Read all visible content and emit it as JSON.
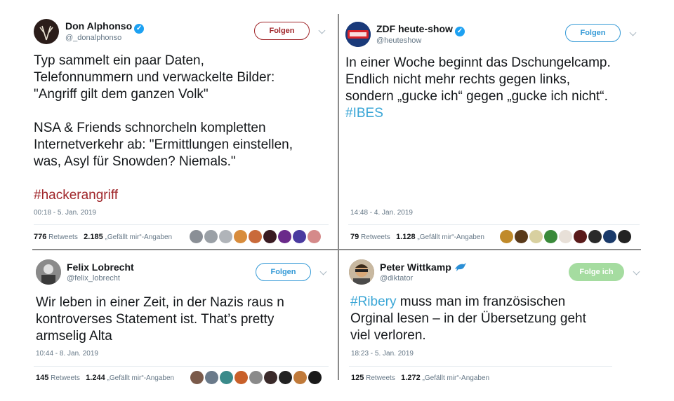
{
  "tweets": [
    {
      "name": "Don Alphonso",
      "handle": "@_donalphonso",
      "verified": true,
      "follow_label": "Folgen",
      "text": [
        "Typ sammelt ein paar Daten,",
        "Telefonnummern und verwackelte Bilder:",
        "\"Angriff gilt dem ganzen Volk\"",
        "",
        "NSA & Friends schnorcheln kompletten",
        "Internetverkehr ab: \"Ermittlungen einstellen,",
        "was, Asyl für Snowden? Niemals.\"",
        ""
      ],
      "hashtag": "#hackerangriff",
      "timestamp": "00:18 - 5. Jan. 2019",
      "retweets": "776",
      "retweets_label": "Retweets",
      "likes": "2.185",
      "likes_label": "„Gefällt mir“-Angaben",
      "avatar_color": "#2b1d1a",
      "face_colors": [
        "#8a8f96",
        "#9aa0a6",
        "#b0b4b9",
        "#d88c3c",
        "#c96a3a",
        "#3a1b22",
        "#6a2a8a",
        "#4a3aa0",
        "#d58a8a"
      ]
    },
    {
      "name": "ZDF heute-show",
      "handle": "@heuteshow",
      "verified": true,
      "follow_label": "Folgen",
      "text": [
        "In einer Woche beginnt das Dschungelcamp.",
        "Endlich nicht mehr rechts gegen links,",
        "sondern „gucke ich“ gegen „gucke ich nicht“."
      ],
      "hashtag": "#IBES",
      "timestamp": "14:48 - 4. Jan. 2019",
      "retweets": "79",
      "retweets_label": "Retweets",
      "likes": "1.128",
      "likes_label": "„Gefällt mir“-Angaben",
      "avatar_color": "#1a3a7a",
      "face_colors": [
        "#c08a2a",
        "#5a3a1a",
        "#d8d0a0",
        "#3a8a3a",
        "#e8e0d8",
        "#5a1a1a",
        "#2a2a2a",
        "#1a3a6a",
        "#222222"
      ]
    },
    {
      "name": "Felix Lobrecht",
      "handle": "@felix_lobrecht",
      "verified": false,
      "follow_label": "Folgen",
      "text": [
        "Wir leben in einer Zeit, in der Nazis raus n",
        "kontroverses Statement ist. That’s pretty",
        "armselig Alta"
      ],
      "hashtag": "",
      "timestamp": "10:44 - 8. Jan. 2019",
      "retweets": "145",
      "retweets_label": "Retweets",
      "likes": "1.244",
      "likes_label": "„Gefällt mir“-Angaben",
      "avatar_color": "#6a6a6a",
      "face_colors": [
        "#7a5a4a",
        "#6a7a8a",
        "#3a8a8a",
        "#c8602a",
        "#8a8a8a",
        "#3a2a2a",
        "#222222",
        "#c07a3a",
        "#1a1a1a"
      ]
    },
    {
      "name": "Peter Wittkamp",
      "handle": "@diktator",
      "verified": false,
      "name_icon": "dolphin-icon",
      "follow_label": "Folge ich",
      "text": [
        "muss man im französischen",
        "Orginal lesen – in der Übersetzung geht",
        "viel verloren."
      ],
      "hashtag": "#Ribery",
      "timestamp": "18:23 - 5. Jan. 2019",
      "retweets": "125",
      "retweets_label": "Retweets",
      "likes": "1.272",
      "likes_label": "„Gefällt mir“-Angaben",
      "avatar_color": "#7a5a3a",
      "face_colors": []
    }
  ],
  "colors": {
    "verified": "#1da1f2",
    "hashtag_red": "#a0262a",
    "hashtag_blue": "#3aa6d6",
    "follow_green": "#a5dca0",
    "divider": "#8a8a8a"
  }
}
